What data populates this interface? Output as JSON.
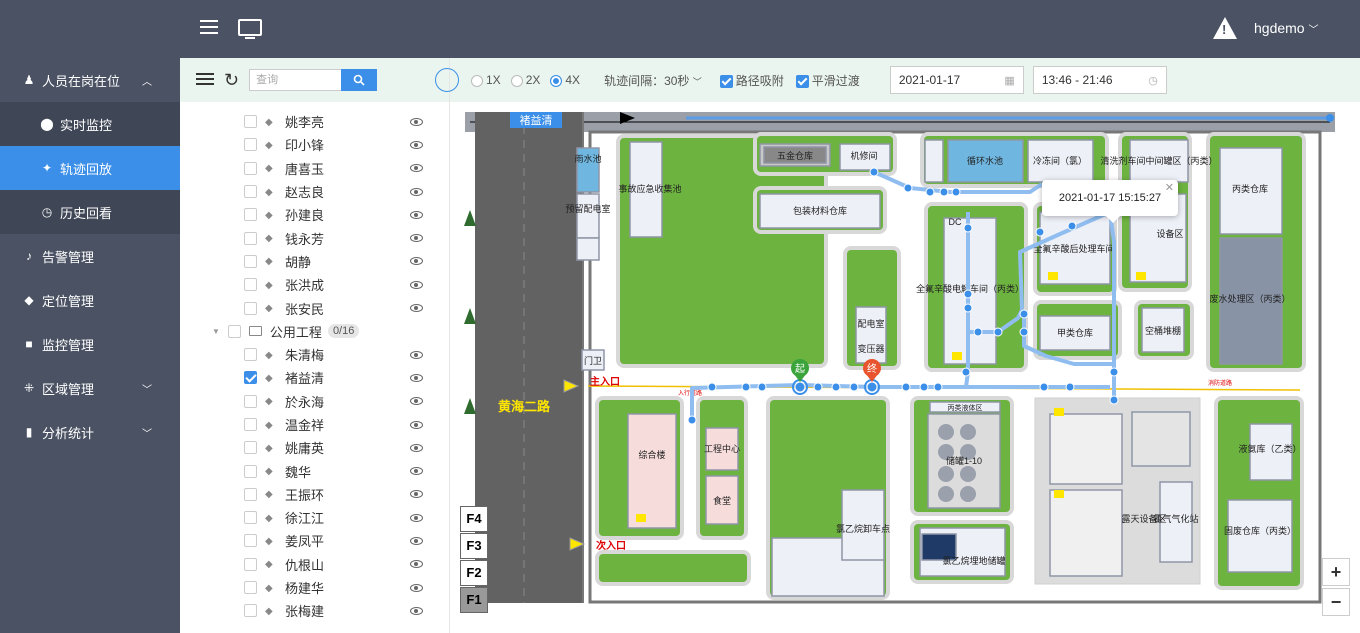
{
  "topbar": {
    "user": "hgdemo"
  },
  "nav": {
    "group_title": "人员在岗在位",
    "sub": [
      "实时监控",
      "轨迹回放",
      "历史回看"
    ],
    "items": [
      "告警管理",
      "定位管理",
      "监控管理",
      "区域管理",
      "分析统计"
    ]
  },
  "tree": {
    "search_placeholder": "查询",
    "people_top": [
      "姚李亮",
      "印小锋",
      "唐喜玉",
      "赵志良",
      "孙建良",
      "钱永芳",
      "胡静",
      "张洪成",
      "张安民"
    ],
    "group": {
      "name": "公用工程",
      "count": "0/16"
    },
    "people_group": [
      "朱清梅",
      "褚益清",
      "於永海",
      "温金祥",
      "姚庸英",
      "魏华",
      "王振环",
      "徐江江",
      "姜凤平",
      "仇根山",
      "杨建华",
      "张梅建"
    ],
    "checked": "褚益清"
  },
  "toolbar": {
    "speeds": [
      "1X",
      "2X",
      "4X"
    ],
    "selected_speed": "4X",
    "interval_label": "轨迹间隔：30秒",
    "path_snap": "路径吸附",
    "smooth": "平滑过渡",
    "date": "2021-01-17",
    "time_range": "13:46 - 21:46"
  },
  "map": {
    "person_label": "褚益清",
    "road": "黄海二路",
    "main_entrance": "主入口",
    "second_entrance": "次入口",
    "start_marker": "起",
    "end_marker": "终",
    "tooltip": "2021-01-17 15:15:27",
    "floors": [
      "F4",
      "F3",
      "F2",
      "F1"
    ],
    "active_floor": "F1",
    "buildings": {
      "rain_pool": "雨水池",
      "reserve": "预留配电室",
      "accident_pool": "事故应急收集池",
      "gate": "门卫",
      "hardware": "五金仓库",
      "repair": "机修间",
      "circ": "循环水池",
      "freeze": "冷冻间（氯）",
      "wash": "清洗剂车间中间罐区（丙类）",
      "c_warehouse": "丙类仓库",
      "packaging": "包装材料仓库",
      "dc": "DC",
      "acid": "全氟辛酸电解车间（丙类）",
      "after": "全氟辛酸后处理车间",
      "equip": "设备区",
      "waste": "废水处理区（丙类）",
      "power": "配电室",
      "transformer": "变压器",
      "a_warehouse": "甲类仓库",
      "air": "空桶堆棚",
      "complex": "综合楼",
      "eng": "工程中心",
      "canteen": "食堂",
      "tank_area": "丙类液体区",
      "tanks": "储罐1-10",
      "unload": "氯乙烷卸车点",
      "buried": "氯乙烷埋地储罐",
      "outdoor": "露天设备区",
      "gasify": "氯气气化站",
      "liquid_ammonia": "液氨库（乙类）",
      "solid_waste": "固废仓库（丙类）",
      "small_entry": "入行道路",
      "fire_road": "消防道路"
    }
  }
}
